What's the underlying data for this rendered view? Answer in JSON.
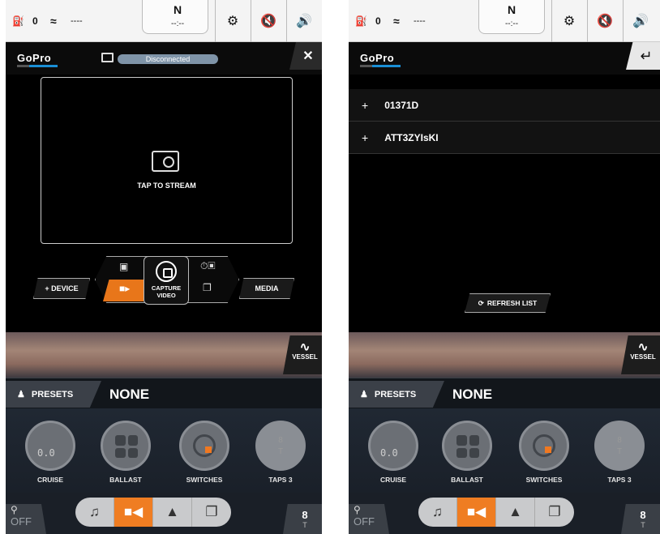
{
  "status_bar": {
    "fuel_value": "0",
    "depth_value": "----",
    "gear": "N",
    "gear_sub": "--:--"
  },
  "left": {
    "connection_status": "Disconnected",
    "brand": "GoPro",
    "stream_label": "TAP TO STREAM",
    "add_device_label": "+ DEVICE",
    "capture_label_1": "CAPTURE",
    "capture_label_2": "VIDEO",
    "media_label": "MEDIA"
  },
  "right": {
    "brand": "GoPro",
    "devices": [
      {
        "name": "01371D"
      },
      {
        "name": "ATT3ZYIsKI"
      }
    ],
    "refresh_label": "REFRESH LIST"
  },
  "vessel_label": "VESSEL",
  "presets": {
    "label": "PRESETS",
    "value": "NONE"
  },
  "dials": {
    "cruise_label": "CRUISE",
    "cruise_value": "0.0",
    "ballast_label": "BALLAST",
    "switches_label": "SWITCHES",
    "taps_label": "TAPS 3",
    "taps_value": "8",
    "taps_unit": "T"
  },
  "bottom": {
    "off_label": "OFF",
    "eight_value": "8",
    "eight_unit": "T",
    "nav_items": [
      "music-icon",
      "video-icon",
      "navigation-icon",
      "pages-icon"
    ]
  },
  "colors": {
    "accent": "#ef7d22",
    "gopro_blue": "#1a8fd6"
  }
}
